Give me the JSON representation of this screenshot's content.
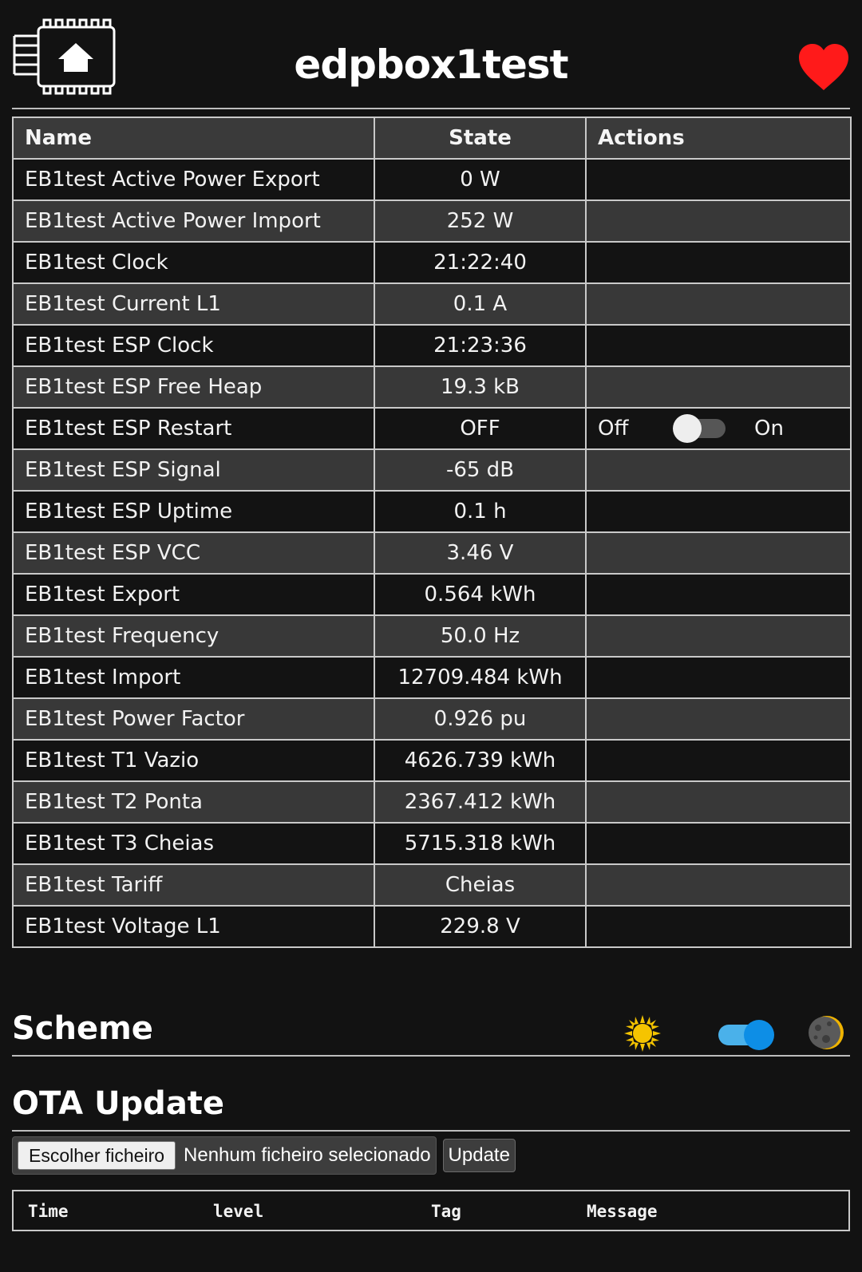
{
  "header": {
    "title": "edpbox1test",
    "logo_icon": "chip-home-icon",
    "heart_icon": "heart-icon",
    "heart_color": "#ff1a1a"
  },
  "table": {
    "headers": {
      "name": "Name",
      "state": "State",
      "actions": "Actions"
    },
    "rows": [
      {
        "name": "EB1test Active Power Export",
        "state": "0 W"
      },
      {
        "name": "EB1test Active Power Import",
        "state": "252 W"
      },
      {
        "name": "EB1test Clock",
        "state": "21:22:40"
      },
      {
        "name": "EB1test Current L1",
        "state": "0.1 A"
      },
      {
        "name": "EB1test ESP Clock",
        "state": "21:23:36"
      },
      {
        "name": "EB1test ESP Free Heap",
        "state": "19.3 kB"
      },
      {
        "name": "EB1test ESP Restart",
        "state": "OFF",
        "switch": {
          "off_label": "Off",
          "on_label": "On",
          "checked": false
        }
      },
      {
        "name": "EB1test ESP Signal",
        "state": "-65 dB"
      },
      {
        "name": "EB1test ESP Uptime",
        "state": "0.1 h"
      },
      {
        "name": "EB1test ESP VCC",
        "state": "3.46 V"
      },
      {
        "name": "EB1test Export",
        "state": "0.564 kWh"
      },
      {
        "name": "EB1test Frequency",
        "state": "50.0 Hz"
      },
      {
        "name": "EB1test Import",
        "state": "12709.484 kWh"
      },
      {
        "name": "EB1test Power Factor",
        "state": "0.926 pu"
      },
      {
        "name": "EB1test T1 Vazio",
        "state": "4626.739 kWh"
      },
      {
        "name": "EB1test T2 Ponta",
        "state": "2367.412 kWh"
      },
      {
        "name": "EB1test T3 Cheias",
        "state": "5715.318 kWh"
      },
      {
        "name": "EB1test Tariff",
        "state": "Cheias"
      },
      {
        "name": "EB1test Voltage L1",
        "state": "229.8 V"
      }
    ]
  },
  "scheme": {
    "title": "Scheme",
    "light_icon": "sun-icon",
    "dark_icon": "moon-icon",
    "dark_enabled": true,
    "toggle_color": "#0d8ee6"
  },
  "ota": {
    "title": "OTA Update",
    "choose_file_label": "Escolher ficheiro",
    "no_file_text": "Nenhum ficheiro selecionado",
    "update_label": "Update"
  },
  "log": {
    "headers": {
      "time": "Time",
      "level": "level",
      "tag": "Tag",
      "message": "Message"
    }
  }
}
